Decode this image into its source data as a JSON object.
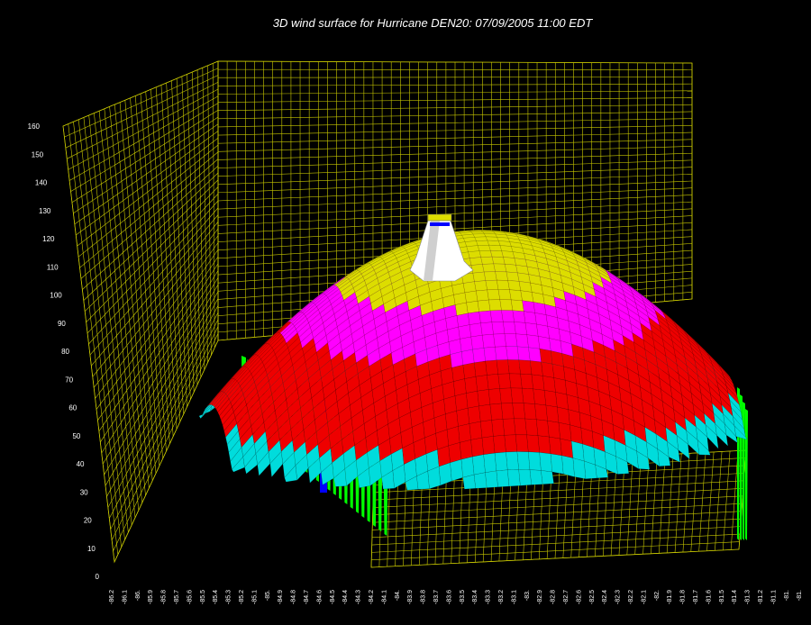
{
  "chart_data": {
    "type": "surface",
    "title": "3D wind surface for Hurricane DEN20: 07/09/2005 11:00 EDT",
    "z_ticks": [
      "0",
      "10",
      "20",
      "30",
      "40",
      "50",
      "60",
      "70",
      "80",
      "90",
      "100",
      "110",
      "120",
      "130",
      "140",
      "150",
      "160"
    ],
    "x_ticks": [
      "-86.2",
      "-86.1",
      "-86.",
      "-85.9",
      "-85.8",
      "-85.7",
      "-85.6",
      "-85.5",
      "-85.4",
      "-85.3",
      "-85.2",
      "-85.1",
      "-85.",
      "-84.9",
      "-84.8",
      "-84.7",
      "-84.6",
      "-84.5",
      "-84.4",
      "-84.3",
      "-84.2",
      "-84.1",
      "-84.",
      "-83.9",
      "-83.8",
      "-83.7",
      "-83.6",
      "-83.5",
      "-83.4",
      "-83.3",
      "-83.2",
      "-83.1",
      "-83.",
      "-82.9",
      "-82.8",
      "-82.7",
      "-82.6",
      "-82.5",
      "-82.4",
      "-82.3",
      "-82.2",
      "-82.1",
      "-82.",
      "-81.9",
      "-81.8",
      "-81.7",
      "-81.6",
      "-81.5",
      "-81.4",
      "-81.3",
      "-81.2",
      "-81.1",
      "-81.",
      "-81."
    ],
    "zlim": [
      0,
      160
    ],
    "grid": true,
    "colors": {
      "grid": "#c8c800",
      "band_1": "#00ff00",
      "band_2": "#00dcdc",
      "band_3": "#ee0000",
      "band_4": "#ff00ff",
      "band_5": "#dddd00",
      "band_6": "#ffffff",
      "band_7": "#0000ff"
    }
  }
}
